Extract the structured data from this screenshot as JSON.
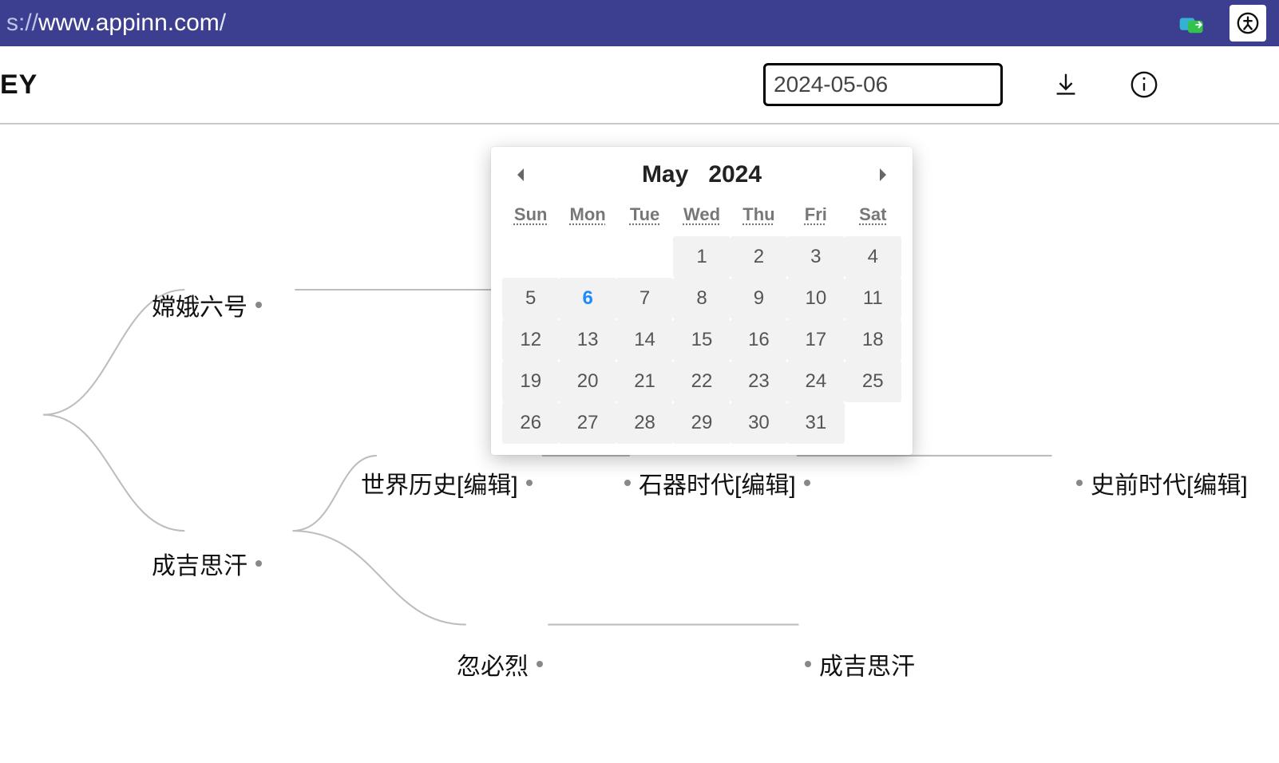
{
  "browser": {
    "url_proto": "s://",
    "url_host": "www.appinn.com",
    "url_path": "/"
  },
  "header": {
    "title": "EY",
    "date_value": "2024-05-06"
  },
  "datepicker": {
    "month_label": "May",
    "year_label": "2024",
    "dow": [
      "Sun",
      "Mon",
      "Tue",
      "Wed",
      "Thu",
      "Fri",
      "Sat"
    ],
    "leading_blanks": 3,
    "days_in_month": 31,
    "selected_day": 6
  },
  "mindmap": {
    "n1": "嫦娥六号",
    "n2": "成吉思汗",
    "n3": "世界历史[编辑]",
    "n4": "忽必烈",
    "n5": "石器时代[编辑]",
    "n6": "成吉思汗",
    "n7": "史前时代[编辑]"
  }
}
